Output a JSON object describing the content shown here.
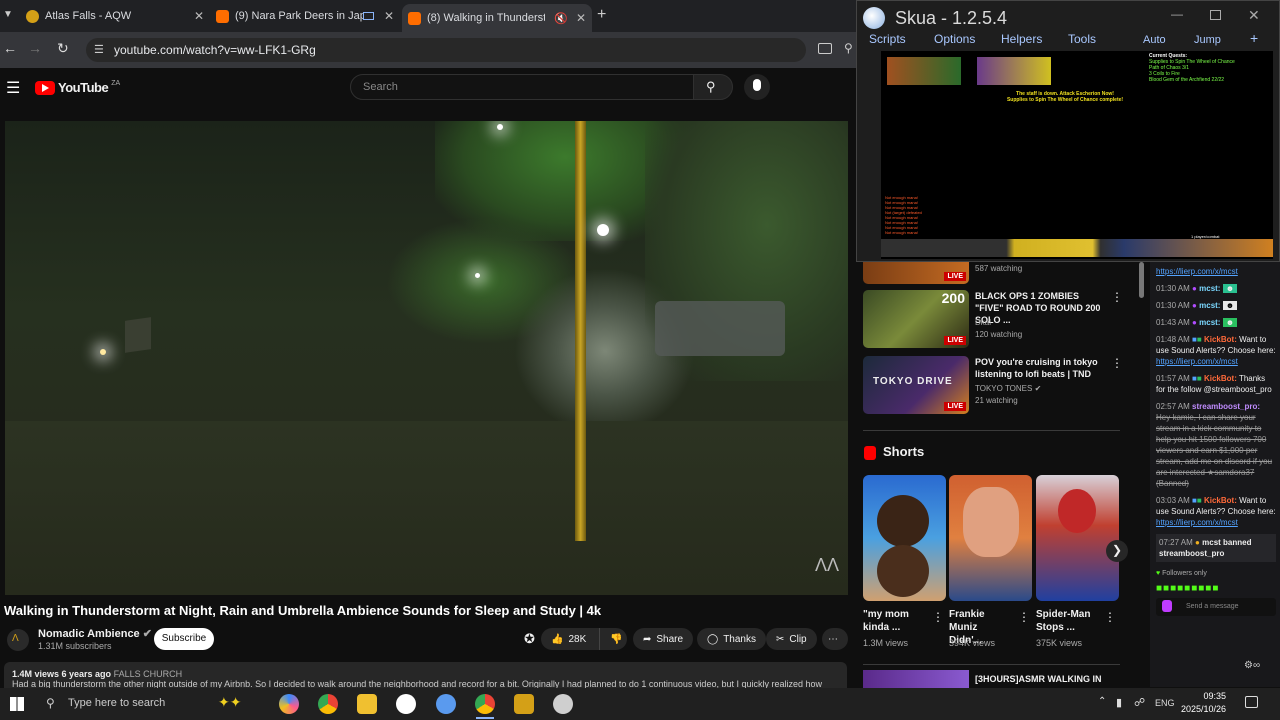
{
  "tabs": [
    {
      "title": "Atlas Falls - AQW",
      "favicon_color": "#d4a017"
    },
    {
      "title": "(9) Nara Park Deers in Japan",
      "favicon_color": "#ff6d00"
    },
    {
      "title": "(8) Walking in Thunderstorm",
      "favicon_color": "#ff6d00"
    }
  ],
  "address": {
    "url": "youtube.com/watch?v=ww-LFK1-GRg"
  },
  "youtube": {
    "logo": "YouTube",
    "region": "ZA",
    "search_placeholder": "Search"
  },
  "video": {
    "title": "Walking in Thunderstorm at Night, Rain and Umbrella Ambience Sounds for Sleep and Study | 4k",
    "channel": "Nomadic Ambience",
    "subscribers": "1.31M subscribers",
    "subscribe_label": "Subscribe",
    "likes": "28K",
    "share_label": "Share",
    "thanks_label": "Thanks",
    "clip_label": "Clip",
    "views_time": "1.4M views  6 years ago",
    "location": "FALLS CHURCH",
    "description": "Had a big thunderstorm the other night outside of my Airbnb. So I decided to walk around the neighborhood and record for a bit. Originally I had planned to do 1 continuous video, but I quickly realized how"
  },
  "recommendations": [
    {
      "title": "",
      "channel": "",
      "stat": "587 watching",
      "live": "LIVE"
    },
    {
      "title": "BLACK OPS 1 ZOMBIES \"FIVE\" ROAD TO ROUND 200 SOLO ...",
      "channel": "Dkal",
      "stat": "120 watching",
      "live": "LIVE"
    },
    {
      "title": "POV you're cruising in tokyo listening to lofi beats | TND",
      "channel": "TOKYO TONES",
      "stat": "21 watching",
      "live": "LIVE"
    }
  ],
  "shorts": {
    "heading": "Shorts",
    "items": [
      {
        "title": "\"my mom kinda ...",
        "views": "1.3M views"
      },
      {
        "title": "Frankie Muniz Didn'...",
        "views": "394K views"
      },
      {
        "title": "Spider-Man Stops ...",
        "views": "375K views"
      }
    ]
  },
  "next_rec": {
    "title": "[3HOURS]ASMR WALKING IN"
  },
  "chat": {
    "messages": [
      {
        "time": "",
        "user": "",
        "text": "https://lierp.com/x/mcst",
        "is_link": true
      },
      {
        "time": "01:30 AM",
        "user": "mcst:",
        "text": ""
      },
      {
        "time": "01:30 AM",
        "user": "mcst:",
        "text": ""
      },
      {
        "time": "01:43 AM",
        "user": "mcst:",
        "text": ""
      },
      {
        "time": "01:48 AM",
        "user": "KickBot:",
        "text": "Want to use Sound Alerts?? Choose here:",
        "link": "https://lierp.com/x/mcst"
      },
      {
        "time": "01:57 AM",
        "user": "KickBot:",
        "text": "Thanks for the follow @streamboost_pro"
      },
      {
        "time": "02:57 AM",
        "user": "streamboost_pro:",
        "text": "Hey kamie, I can share your stream in a kick community to help you hit 1500 followers 700 viewers and earn $1,000 per stream, add me on discord if you are interected ★samdora37 (Banned)"
      },
      {
        "time": "03:03 AM",
        "user": "KickBot:",
        "text": "Want to use Sound Alerts?? Choose here:",
        "link": "https://lierp.com/x/mcst"
      },
      {
        "time": "07:27 AM",
        "user": "mcst banned",
        "text": "streamboost_pro"
      }
    ],
    "followers_only": "Followers only",
    "send_label": "Send a message"
  },
  "skua": {
    "title": "Skua - 1.2.5.4",
    "menu": [
      "Scripts",
      "Options",
      "Helpers",
      "Tools"
    ],
    "menu_right": [
      "Auto",
      "Jump",
      "+"
    ],
    "quest_header": "Current Quests:",
    "quest_lines": [
      "Supplies to Spin The Wheel of Chance",
      "Path of Chaos 3/1",
      "3 Coils to Fire",
      "Blood Gem of the Archfiend 22/22"
    ],
    "game_msg": "The staff is down.   Attack Escherion Now! Supplies to Spin The Wheel of Chance complete!",
    "log": [
      "Not enough mana!",
      "Not enough mana!",
      "Not enough mana!",
      "Not (target) defeated",
      "Not enough mana!",
      "Not enough mana!",
      "Not enough mana!",
      "Not enough mana!"
    ],
    "player_count": "1 player/combat"
  },
  "taskbar": {
    "search_placeholder": "Type here to search",
    "lang": "ENG",
    "time": "09:35",
    "date": "2025/10/26"
  }
}
